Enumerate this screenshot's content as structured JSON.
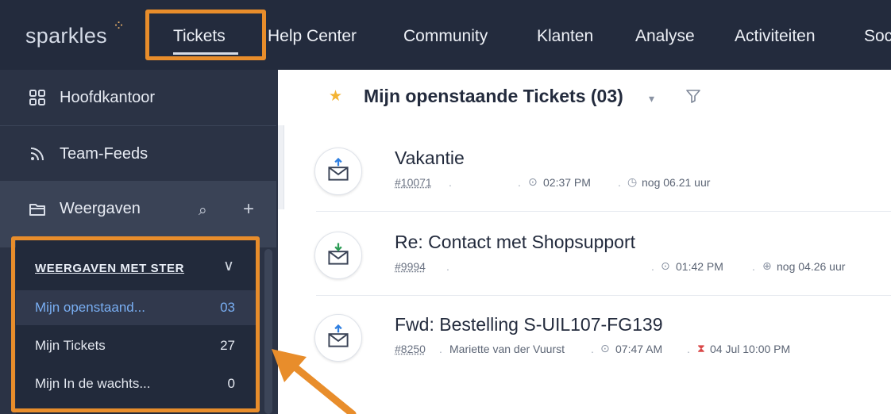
{
  "brand": {
    "name": "sparkles",
    "sparks": "⁘"
  },
  "nav": {
    "items": [
      "Tickets",
      "Help Center",
      "Community",
      "Klanten",
      "Analyse",
      "Activiteiten",
      "Soc"
    ],
    "active": "Tickets"
  },
  "sidebar": {
    "items": [
      {
        "label": "Hoofdkantoor",
        "icon": "grid-icon"
      },
      {
        "label": "Team-Feeds",
        "icon": "rss-icon"
      },
      {
        "label": "Weergaven",
        "icon": "folder-icon"
      }
    ],
    "tools": {
      "search": "⌕",
      "add": "+"
    }
  },
  "starred": {
    "heading": "WEERGAVEN MET STER",
    "chevron": "∨",
    "items": [
      {
        "label": "Mijn openstaand...",
        "count": "03"
      },
      {
        "label": "Mijn Tickets",
        "count": "27"
      },
      {
        "label": "Mijn In de wachts...",
        "count": "0"
      }
    ]
  },
  "view": {
    "star": "★",
    "title": "Mijn openstaande Tickets (03)",
    "caret": "▾"
  },
  "tickets": [
    {
      "subject": "Vakantie",
      "number": "#10071",
      "contact": "",
      "time": "02:37 PM",
      "sla_text": "nog 06.21 uur"
    },
    {
      "subject": "Re: Contact met Shopsupport",
      "number": "#9994",
      "contact": "",
      "time": "01:42 PM",
      "sla_text": "nog 04.26 uur"
    },
    {
      "subject": "Fwd: Bestelling S-UIL107-FG139",
      "number": "#8250",
      "contact": "Mariette van der Vuurst",
      "time": "07:47 AM",
      "sla_text": "04 Jul 10:00 PM"
    }
  ],
  "colors": {
    "topbar": "#232b3d",
    "sidebar": "#2b3345",
    "highlight": "#e88d2b",
    "active_item_text": "#79aef2",
    "star": "#f3b333"
  }
}
